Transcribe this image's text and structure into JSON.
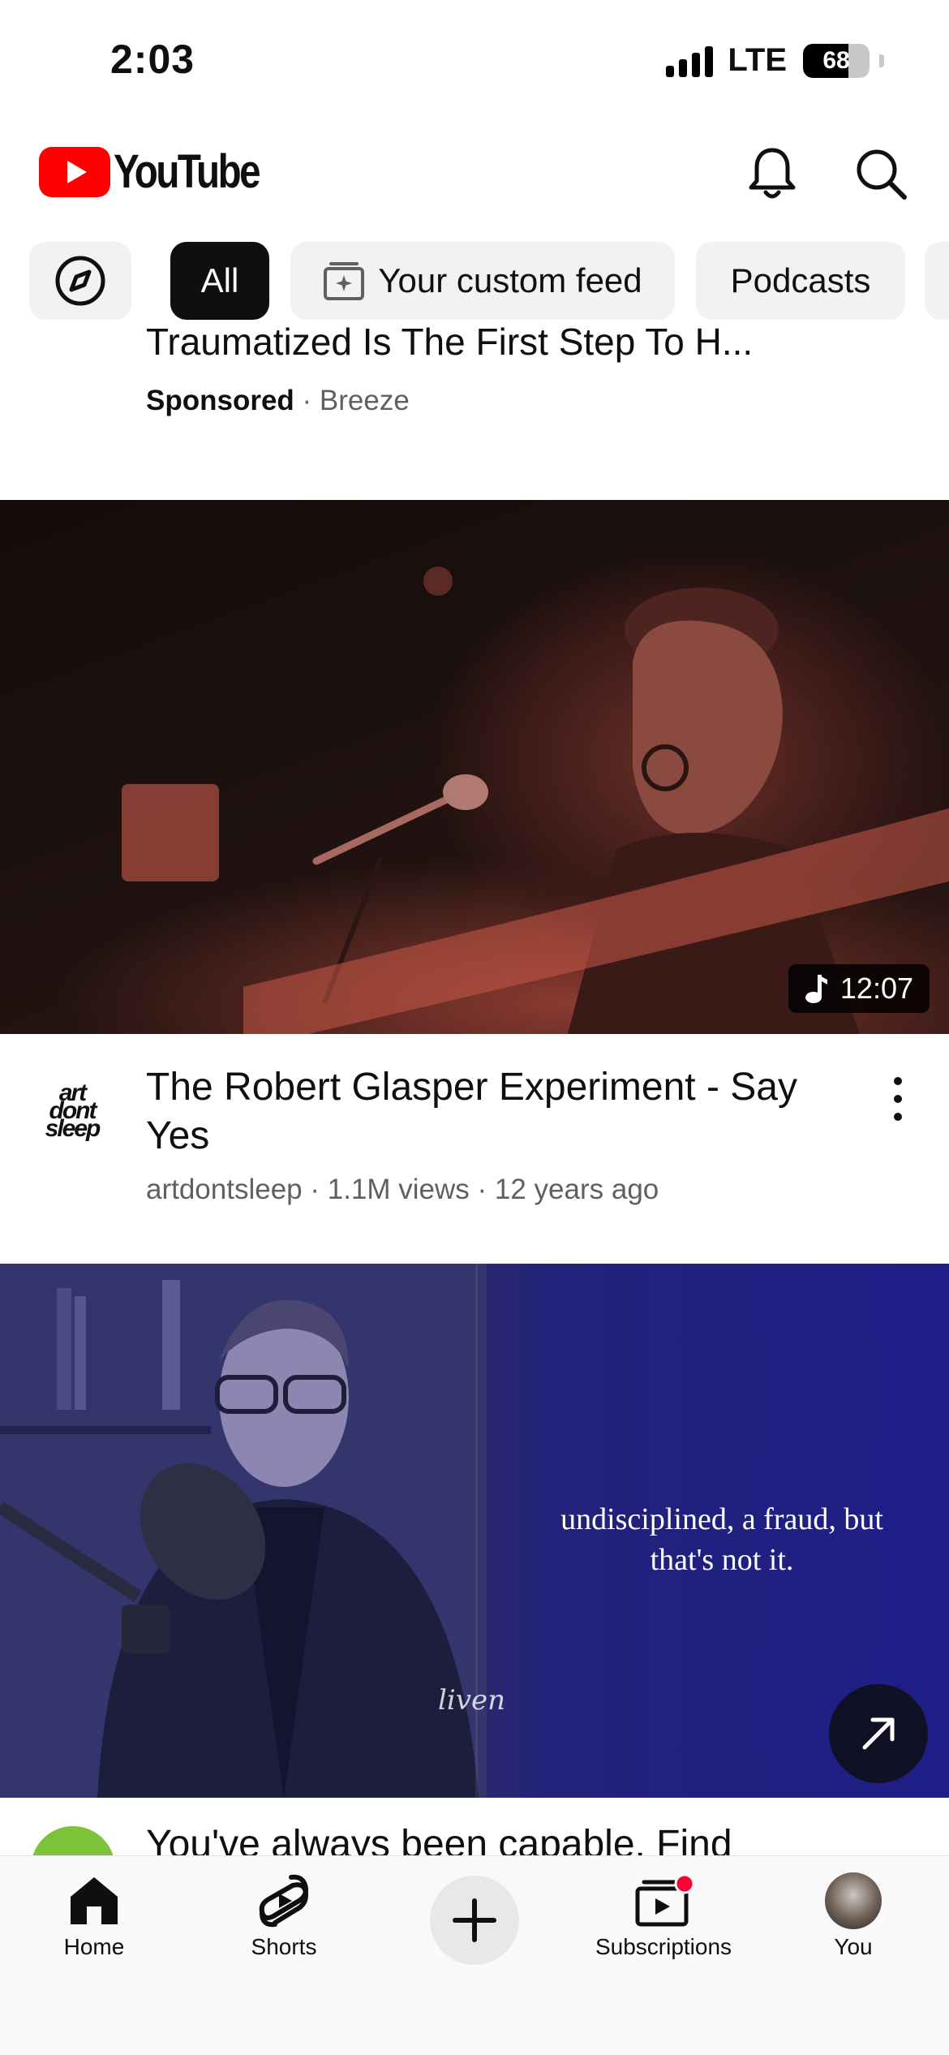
{
  "status_bar": {
    "time": "2:03",
    "network": "LTE",
    "battery": "68"
  },
  "header": {
    "logo_text": "YouTube",
    "icons": [
      "bell-icon",
      "search-icon"
    ]
  },
  "chips": {
    "explore_icon": "compass-icon",
    "items": [
      "All",
      "Your custom feed",
      "Podcasts"
    ],
    "active": "All"
  },
  "feed": {
    "sponsored": {
      "title": "Traumatized Is The First Step To H...",
      "label": "Sponsored",
      "advertiser": "Breeze"
    },
    "video1": {
      "duration": "12:07",
      "channel_avatar_text": "art dont sleep",
      "title": "The Robert Glasper Experiment - Say Yes",
      "meta": "artdontsleep · 1.1M views · 12 years ago"
    },
    "video2": {
      "overlay_quote": "undisciplined, a fraud, but that's not it.",
      "watermark": "liven",
      "partial_title": "You've always been capable. Find"
    }
  },
  "bottom_nav": {
    "home": "Home",
    "shorts": "Shorts",
    "subscriptions": "Subscriptions",
    "you": "You"
  },
  "colors": {
    "brand_red": "#ff0000",
    "chip_bg": "#f2f2f2",
    "chip_active_bg": "#0f0f0f",
    "meta_text": "#606060"
  }
}
